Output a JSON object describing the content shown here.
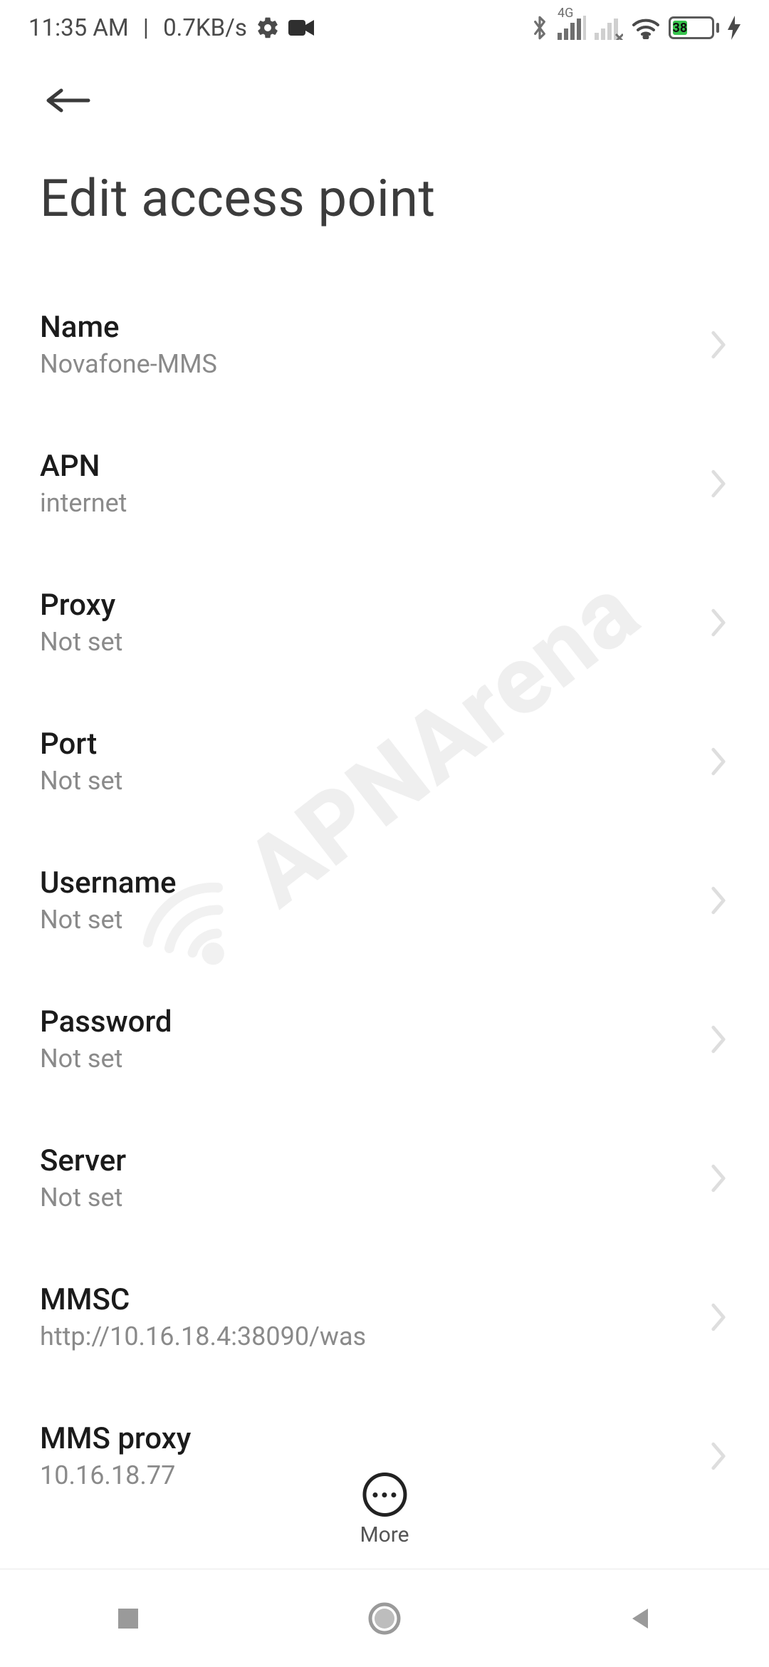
{
  "status": {
    "time": "11:35 AM",
    "net_speed": "0.7KB/s",
    "network_label": "4G",
    "battery_percent": "38",
    "icons": {
      "settings": "settings-icon",
      "camera": "camera-icon",
      "bluetooth": "bluetooth-icon",
      "signal1": "signal-4g-icon",
      "signal2": "signal-no-sim-icon",
      "wifi": "wifi-icon",
      "bolt": "charging-bolt-icon"
    }
  },
  "page": {
    "title": "Edit access point"
  },
  "settings": [
    {
      "key": "name",
      "label": "Name",
      "value": "Novafone-MMS"
    },
    {
      "key": "apn",
      "label": "APN",
      "value": "internet"
    },
    {
      "key": "proxy",
      "label": "Proxy",
      "value": "Not set"
    },
    {
      "key": "port",
      "label": "Port",
      "value": "Not set"
    },
    {
      "key": "username",
      "label": "Username",
      "value": "Not set"
    },
    {
      "key": "password",
      "label": "Password",
      "value": "Not set"
    },
    {
      "key": "server",
      "label": "Server",
      "value": "Not set"
    },
    {
      "key": "mmsc",
      "label": "MMSC",
      "value": "http://10.16.18.4:38090/was"
    },
    {
      "key": "mms_proxy",
      "label": "MMS proxy",
      "value": "10.16.18.77"
    }
  ],
  "bottom_action": {
    "label": "More"
  },
  "watermark": {
    "text": "APNArena"
  }
}
